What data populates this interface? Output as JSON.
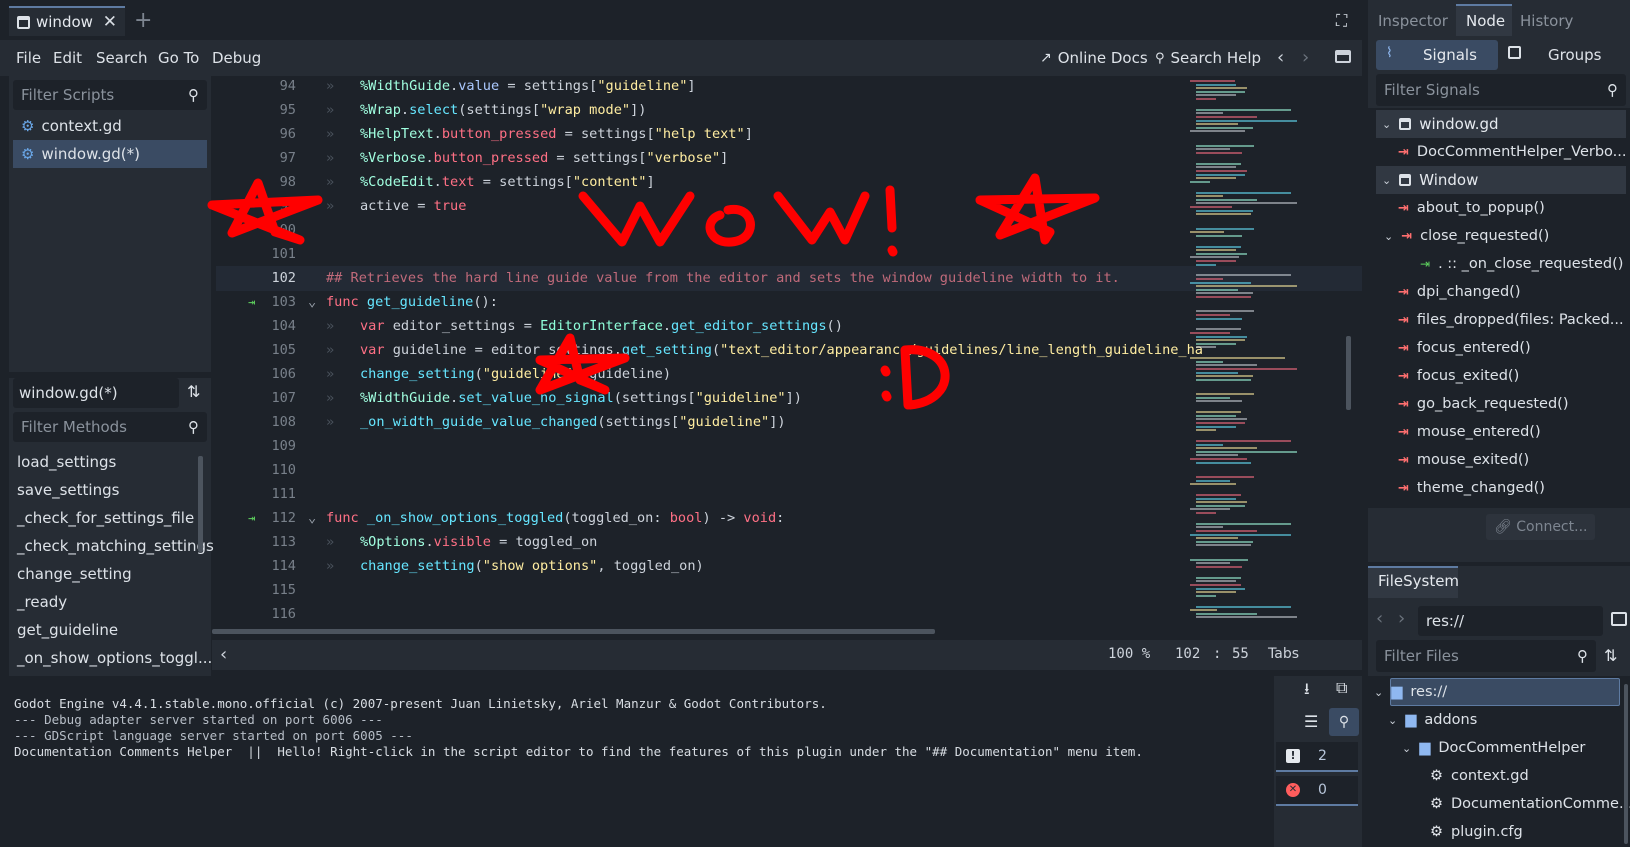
{
  "tabs": {
    "active_label": "window",
    "close_glyph": "✕",
    "add_glyph": "+"
  },
  "menu": {
    "items": [
      "File",
      "Edit",
      "Search",
      "Go To",
      "Debug"
    ],
    "online_docs": "Online Docs",
    "search_help": "Search Help"
  },
  "scripts": {
    "filter_placeholder": "Filter Scripts",
    "items": [
      "context.gd",
      "window.gd(*)"
    ],
    "current": "window.gd(*)"
  },
  "methods": {
    "filter_placeholder": "Filter Methods",
    "items": [
      "load_settings",
      "save_settings",
      "_check_for_settings_file",
      "_check_matching_settings",
      "change_setting",
      "_ready",
      "get_guideline",
      "_on_show_options_toggl..."
    ]
  },
  "editor": {
    "lines": [
      {
        "num": "94",
        "segs": [
          [
            "n",
            "%WidthGuide"
          ],
          [
            "w",
            "."
          ],
          [
            "p",
            "value"
          ],
          [
            "w",
            " = settings["
          ],
          [
            "s",
            "\"guideline\""
          ],
          [
            "w",
            "]"
          ]
        ]
      },
      {
        "num": "95",
        "segs": [
          [
            "n",
            "%Wrap"
          ],
          [
            "w",
            "."
          ],
          [
            "f",
            "select"
          ],
          [
            "w",
            "(settings["
          ],
          [
            "s",
            "\"wrap mode\""
          ],
          [
            "w",
            "])"
          ]
        ]
      },
      {
        "num": "96",
        "segs": [
          [
            "n",
            "%HelpText"
          ],
          [
            "w",
            "."
          ],
          [
            "k",
            "button_pressed"
          ],
          [
            "w",
            " = settings["
          ],
          [
            "s",
            "\"help text\""
          ],
          [
            "w",
            "]"
          ]
        ]
      },
      {
        "num": "97",
        "segs": [
          [
            "n",
            "%Verbose"
          ],
          [
            "w",
            "."
          ],
          [
            "k",
            "button_pressed"
          ],
          [
            "w",
            " = settings["
          ],
          [
            "s",
            "\"verbose\""
          ],
          [
            "w",
            "]"
          ]
        ]
      },
      {
        "num": "98",
        "segs": [
          [
            "n",
            "%CodeEdit"
          ],
          [
            "w",
            "."
          ],
          [
            "k",
            "text"
          ],
          [
            "w",
            " = settings["
          ],
          [
            "s",
            "\"content\""
          ],
          [
            "w",
            "]"
          ]
        ]
      },
      {
        "num": "99",
        "segs": [
          [
            "w",
            "active = "
          ],
          [
            "k",
            "true"
          ]
        ]
      },
      {
        "num": "100",
        "segs": []
      },
      {
        "num": "101",
        "segs": []
      },
      {
        "num": "102",
        "segs": [
          [
            "com",
            "## Retrieves the hard line guide value from the editor and sets the window guideline width to it."
          ]
        ]
      },
      {
        "num": "103",
        "segs": [
          [
            "k",
            "func "
          ],
          [
            "f",
            "get_guideline"
          ],
          [
            "w",
            "():"
          ]
        ]
      },
      {
        "num": "104",
        "segs": [
          [
            "k",
            "var "
          ],
          [
            "w",
            "editor_settings = "
          ],
          [
            "b",
            "EditorInterface"
          ],
          [
            "w",
            "."
          ],
          [
            "f",
            "get_editor_settings"
          ],
          [
            "w",
            "()"
          ]
        ]
      },
      {
        "num": "105",
        "segs": [
          [
            "k",
            "var "
          ],
          [
            "w",
            "guideline = editor_settings."
          ],
          [
            "f",
            "get_setting"
          ],
          [
            "w",
            "("
          ],
          [
            "s",
            "\"text_editor/appearance/guidelines/line_length_guideline_ha"
          ]
        ]
      },
      {
        "num": "106",
        "segs": [
          [
            "f",
            "change_setting"
          ],
          [
            "w",
            "("
          ],
          [
            "s",
            "\"guideline\""
          ],
          [
            "w",
            ", guideline)"
          ]
        ]
      },
      {
        "num": "107",
        "segs": [
          [
            "n",
            "%WidthGuide"
          ],
          [
            "w",
            "."
          ],
          [
            "f",
            "set_value_no_signal"
          ],
          [
            "w",
            "(settings["
          ],
          [
            "s",
            "\"guideline\""
          ],
          [
            "w",
            "])"
          ]
        ]
      },
      {
        "num": "108",
        "segs": [
          [
            "f",
            "_on_width_guide_value_changed"
          ],
          [
            "w",
            "(settings["
          ],
          [
            "s",
            "\"guideline\""
          ],
          [
            "w",
            "])"
          ]
        ]
      },
      {
        "num": "109",
        "segs": []
      },
      {
        "num": "110",
        "segs": []
      },
      {
        "num": "111",
        "segs": []
      },
      {
        "num": "112",
        "segs": [
          [
            "k",
            "func "
          ],
          [
            "f",
            "_on_show_options_toggled"
          ],
          [
            "w",
            "(toggled_on: "
          ],
          [
            "k",
            "bool"
          ],
          [
            "w",
            ") -> "
          ],
          [
            "k",
            "void"
          ],
          [
            "w",
            ":"
          ]
        ]
      },
      {
        "num": "113",
        "segs": [
          [
            "n",
            "%Options"
          ],
          [
            "w",
            "."
          ],
          [
            "k",
            "visible"
          ],
          [
            "w",
            " = toggled_on"
          ]
        ]
      },
      {
        "num": "114",
        "segs": [
          [
            "f",
            "change_setting"
          ],
          [
            "w",
            "("
          ],
          [
            "s",
            "\"show options\""
          ],
          [
            "w",
            ", toggled_on)"
          ]
        ]
      },
      {
        "num": "115",
        "segs": []
      },
      {
        "num": "116",
        "segs": []
      }
    ],
    "annotation_wow": "wow!",
    "annotation_smile": ":D"
  },
  "status": {
    "zoom": "100 %",
    "line": "102",
    "col": "55",
    "indent": "Tabs"
  },
  "output": {
    "lines": [
      "Godot Engine v4.4.1.stable.mono.official (c) 2007-present Juan Linietsky, Ariel Manzur & Godot Contributors.",
      "--- Debug adapter server started on port 6006 ---",
      "--- GDScript language server started on port 6005 ---",
      "Documentation Comments Helper  ||  Hello! Right-click in the script editor to find the features of this plugin under the \"## Documentation\" menu item."
    ],
    "warnings": "2",
    "errors": "0"
  },
  "dock": {
    "tabs": [
      "Inspector",
      "Node",
      "History"
    ],
    "signals_tab": "Signals",
    "groups_tab": "Groups",
    "filter_placeholder": "Filter Signals",
    "sections": [
      "window.gd",
      "Window"
    ],
    "window_gd_signals": [
      "DocCommentHelper_Verbo..."
    ],
    "window_signals": [
      "about_to_popup()",
      "close_requested()",
      "dpi_changed()",
      "files_dropped(files: Packed...",
      "focus_entered()",
      "focus_exited()",
      "go_back_requested()",
      "mouse_entered()",
      "mouse_exited()",
      "theme_changed()"
    ],
    "connection": ". :: _on_close_requested()",
    "connect_button": "Connect..."
  },
  "filesystem": {
    "title": "FileSystem",
    "path": "res://",
    "filter_placeholder": "Filter Files",
    "items": [
      "res://",
      "addons",
      "DocCommentHelper",
      "context.gd",
      "DocumentationComme...",
      "plugin.cfg"
    ]
  },
  "colors": {
    "accent": "#5e7ba2",
    "signal": "#ff6f6f",
    "annotation": "#ff0000"
  }
}
